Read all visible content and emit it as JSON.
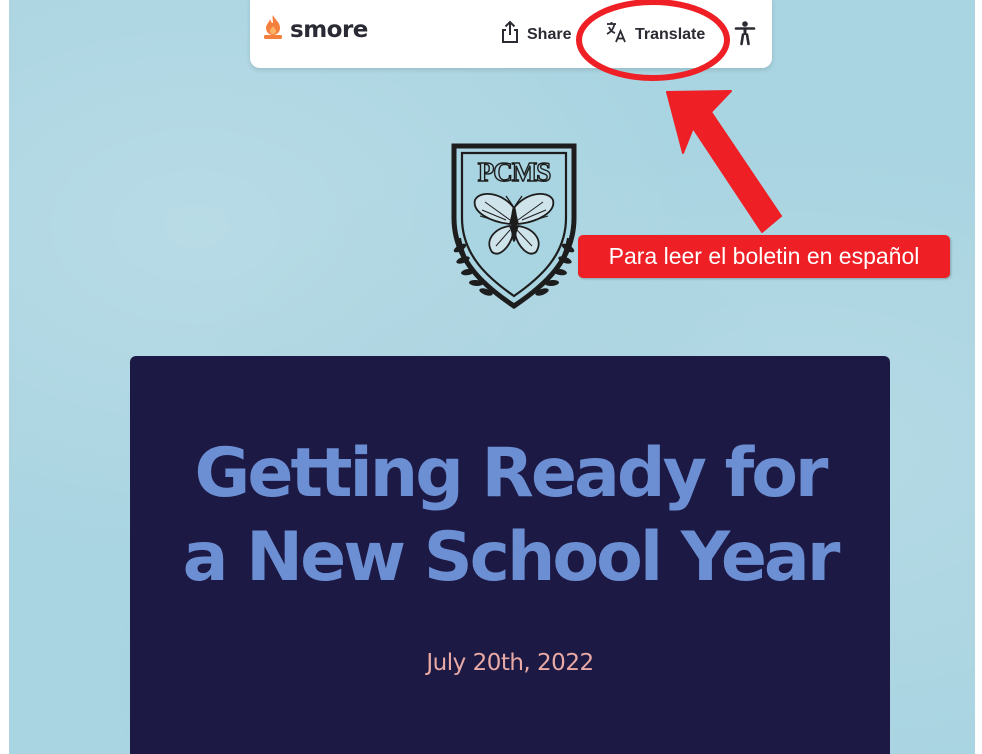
{
  "toolbar": {
    "brand": "smore",
    "share_label": "Share",
    "translate_label": "Translate"
  },
  "annotation": {
    "label": "Para leer el boletin en español"
  },
  "crest": {
    "text": "PCMS"
  },
  "hero": {
    "title_line1": "Getting Ready for",
    "title_line2": "a New School Year",
    "date": "July 20th, 2022"
  },
  "colors": {
    "background": "#a9d4e1",
    "hero_bg": "#1c1945",
    "title": "#6c8fd3",
    "date": "#e9a9a4",
    "annotation_red": "#ee1f25",
    "brand_flame": "#f5803e"
  },
  "icons": {
    "brand": "flame-icon",
    "share": "share-icon",
    "translate": "translate-icon",
    "accessibility": "accessibility-icon"
  }
}
